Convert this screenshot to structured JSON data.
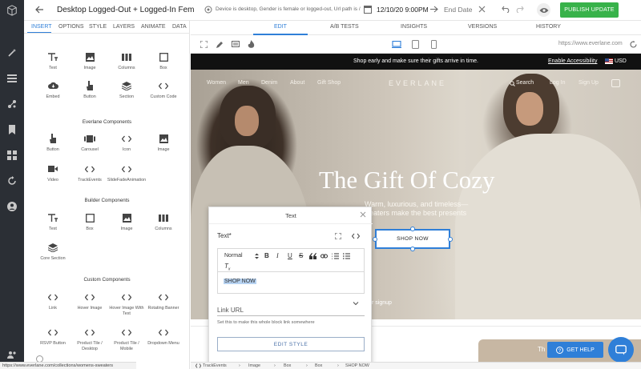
{
  "header": {
    "title": "Desktop Logged-Out + Logged-In Female I",
    "targeting": "Device is desktop, Gender is female or logged-out, Url path is /",
    "start_date": "12/10/20 9:00PM",
    "end_date_placeholder": "End Date",
    "publish_label": "PUBLISH UPDATE"
  },
  "sidebar": {
    "tabs": [
      "INSERT",
      "OPTIONS",
      "STYLE",
      "LAYERS",
      "ANIMATE",
      "DATA"
    ],
    "basic": [
      "Text",
      "Image",
      "Columns",
      "Box",
      "Embed",
      "Button",
      "Section",
      "Custom Code"
    ],
    "everlane_title": "Everlane Components",
    "everlane": [
      "Button",
      "Carousel",
      "Icon",
      "Image",
      "Video",
      "TrackEvents",
      "SlideFadeAnimation"
    ],
    "builder_title": "Builder Components",
    "builder": [
      "Text",
      "Box",
      "Image",
      "Columns",
      "Core Section"
    ],
    "custom_title": "Custom Components",
    "custom": [
      "Link",
      "Hover Image",
      "Hover Image With Text",
      "Rotating Banner",
      "RSVP Button",
      "Product Tile / Desktop",
      "Product Tile / Mobile",
      "Dropdown Menu"
    ]
  },
  "edit_tabs": [
    "EDIT",
    "A/B TESTS",
    "INSIGHTS",
    "VERSIONS",
    "HISTORY"
  ],
  "preview_url": "https://www.everlane.com",
  "canvas": {
    "promo": "Shop early and make sure their gifts arrive in time.",
    "accessibility": "Enable Accessibility",
    "currency": "USD",
    "nav_left": [
      "Women",
      "Men",
      "Denim",
      "About",
      "Gift Shop"
    ],
    "brand": "EVERLANE",
    "nav_right": [
      "Search",
      "Log In",
      "Sign Up"
    ],
    "hero_title": "The Gift Of Cozy",
    "hero_sub_1": "Warm, luxurious, and timeless—",
    "hero_sub_2": "sweaters make the best presents",
    "shop_button": "SHOP NOW",
    "signup_fragment": "r signup",
    "bottom_card": "Th"
  },
  "modal": {
    "title": "Text",
    "field_label": "Text*",
    "format_select": "Normal",
    "content": "SHOP NOW",
    "link_label": "Link URL",
    "link_help": "Set this to make this whole block link somewhere",
    "edit_style": "EDIT STYLE"
  },
  "status_url": "https://www.everlane.com/collections/womens-sweaters",
  "breadcrumb": [
    "TrackEvents",
    "Image",
    "Box",
    "Box",
    "SHOP NOW"
  ],
  "help": {
    "label": "GET HELP"
  },
  "colors": {
    "accent": "#2f7fd8",
    "publish": "#38b24a",
    "rail": "#2b2f35"
  }
}
